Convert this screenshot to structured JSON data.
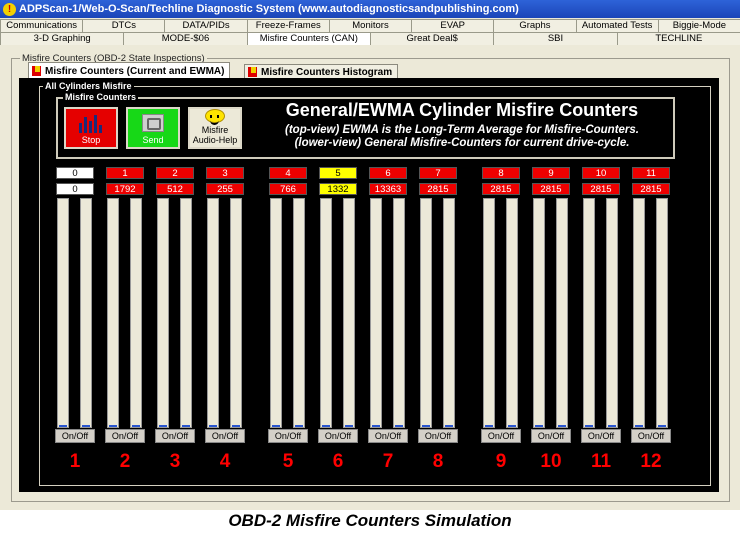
{
  "window": {
    "title": "ADPScan-1/Web-O-Scan/Techline Diagnostic System    (www.autodiagnosticsandpublishing.com)"
  },
  "tabs_row1": [
    "Communications",
    "DTCs",
    "DATA/PIDs",
    "Freeze-Frames",
    "Monitors",
    "EVAP",
    "Graphs",
    "Automated Tests",
    "Biggie-Mode"
  ],
  "tabs_row2": [
    "3-D Graphing",
    "MODE-$06",
    "Misfire Counters (CAN)",
    "Great Deal$",
    "SBI",
    "TECHLINE"
  ],
  "active_tab_row2_index": 2,
  "outer_group_label": "Misfire Counters (OBD-2 State Inspections)",
  "subtabs": [
    "Misfire Counters (Current and EWMA)",
    "Misfire Counters Histogram"
  ],
  "all_cyl_label": "All Cylinders Misfire",
  "misfire_counters_label": "Misfire Counters",
  "buttons": {
    "stop": "Stop",
    "send": "Send",
    "audio_line1": "Misfire",
    "audio_line2": "Audio-Help"
  },
  "heading": "General/EWMA Cylinder Misfire Counters",
  "subheading1": "(top-view) EWMA is the Long-Term Average for Misfire-Counters.",
  "subheading2": "(lower-view) General Misfire-Counters for current drive-cycle.",
  "onoff_label": "On/Off",
  "cylinders": [
    {
      "num": "1",
      "top": "0",
      "low": "0",
      "color": "white",
      "fill": 0.0
    },
    {
      "num": "2",
      "top": "1",
      "low": "1792",
      "color": "red",
      "fill": 0.01
    },
    {
      "num": "3",
      "top": "2",
      "low": "512",
      "color": "red",
      "fill": 0.01
    },
    {
      "num": "4",
      "top": "3",
      "low": "255",
      "color": "red",
      "fill": 0.01
    },
    {
      "num": "5",
      "top": "4",
      "low": "766",
      "color": "red",
      "fill": 0.01
    },
    {
      "num": "6",
      "top": "5",
      "low": "1332",
      "color": "yellow",
      "fill": 0.01
    },
    {
      "num": "7",
      "top": "6",
      "low": "13363",
      "color": "red",
      "fill": 0.01
    },
    {
      "num": "8",
      "top": "7",
      "low": "2815",
      "color": "red",
      "fill": 0.01
    },
    {
      "num": "9",
      "top": "8",
      "low": "2815",
      "color": "red",
      "fill": 0.01
    },
    {
      "num": "10",
      "top": "9",
      "low": "2815",
      "color": "red",
      "fill": 0.01
    },
    {
      "num": "11",
      "top": "10",
      "low": "2815",
      "color": "red",
      "fill": 0.01
    },
    {
      "num": "12",
      "top": "11",
      "low": "2815",
      "color": "red",
      "fill": 0.01
    }
  ],
  "caption": "OBD-2 Misfire Counters Simulation"
}
